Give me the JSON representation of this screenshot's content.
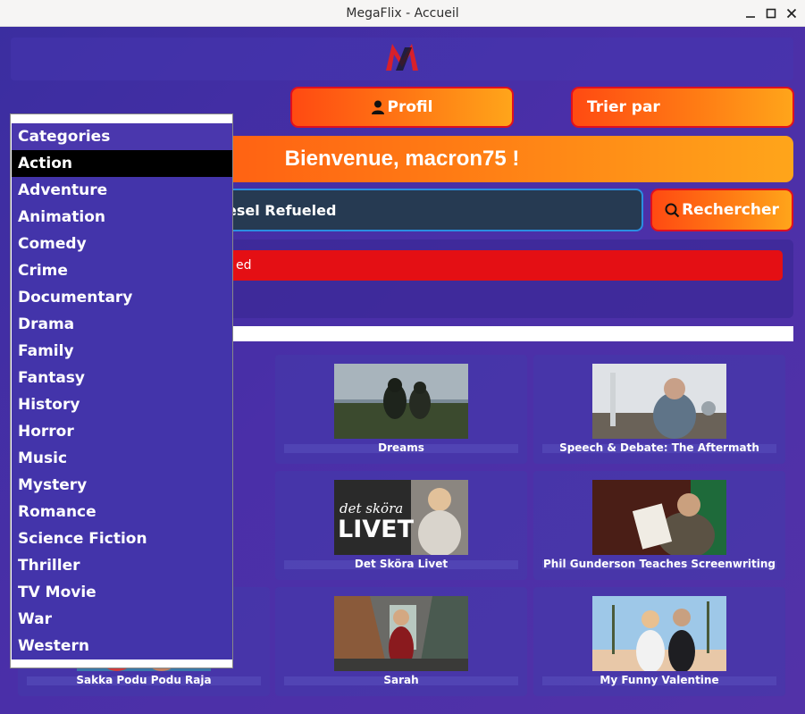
{
  "window": {
    "title": "MegaFlix - Accueil",
    "minimize": "🗕",
    "maximize": "☐",
    "close": "✕"
  },
  "header": {
    "logo_icon": "megaflix-logo-icon"
  },
  "buttons": {
    "profile_label": "Profil",
    "sort_label": "Trier par",
    "search_label": "Rechercher"
  },
  "welcome": {
    "text": "Bienvenue, macron75 !"
  },
  "search": {
    "value": "esel Refueled"
  },
  "results": {
    "first": "ed"
  },
  "categories": {
    "header": "Categories",
    "selected": "Action",
    "items": [
      "Action",
      "Adventure",
      "Animation",
      "Comedy",
      "Crime",
      "Documentary",
      "Drama",
      "Family",
      "Fantasy",
      "History",
      "Horror",
      "Music",
      "Mystery",
      "Romance",
      "Science Fiction",
      "Thriller",
      "TV Movie",
      "War",
      "Western"
    ]
  },
  "movies": [
    {
      "title": "Dreams",
      "thumb": "dreams"
    },
    {
      "title": "Speech & Debate: The Aftermath",
      "thumb": "speech"
    },
    {
      "title": "Det Sköra Livet",
      "thumb": "livet",
      "thumb_text_1": "det sköra",
      "thumb_text_2": "LIVET"
    },
    {
      "title": "Phil Gunderson Teaches Screenwriting",
      "thumb": "phil"
    },
    {
      "title": "Sakka Podu Podu Raja",
      "thumb": "sakka"
    },
    {
      "title": "Sarah",
      "thumb": "sarah"
    },
    {
      "title": "My Funny Valentine",
      "thumb": "valentine"
    }
  ],
  "colors": {
    "accent_orange": "#ff7a14",
    "border_red": "#e01020",
    "selected_bg": "#000000",
    "background": "#4a2fa8"
  }
}
